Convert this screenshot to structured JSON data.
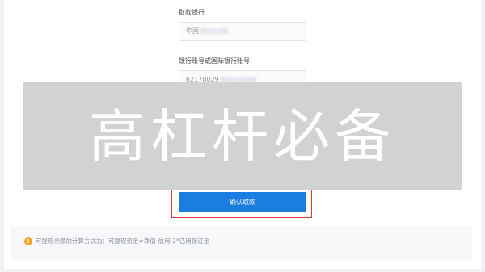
{
  "form": {
    "bank_label": "取款银行",
    "bank_value": "中国",
    "account_label": "银行账号或国际银行账号:",
    "account_value": "62170029",
    "confirm_label": "确认取款"
  },
  "watermark": {
    "text": "高杠杆必备"
  },
  "notice": {
    "icon": "!",
    "text": "可提现余额的计算方式为：可提现资金=净值-信用-2*已用保证金"
  },
  "colors": {
    "primary": "#1b7de0",
    "highlight": "#e2393f",
    "warning": "#f5a623"
  }
}
